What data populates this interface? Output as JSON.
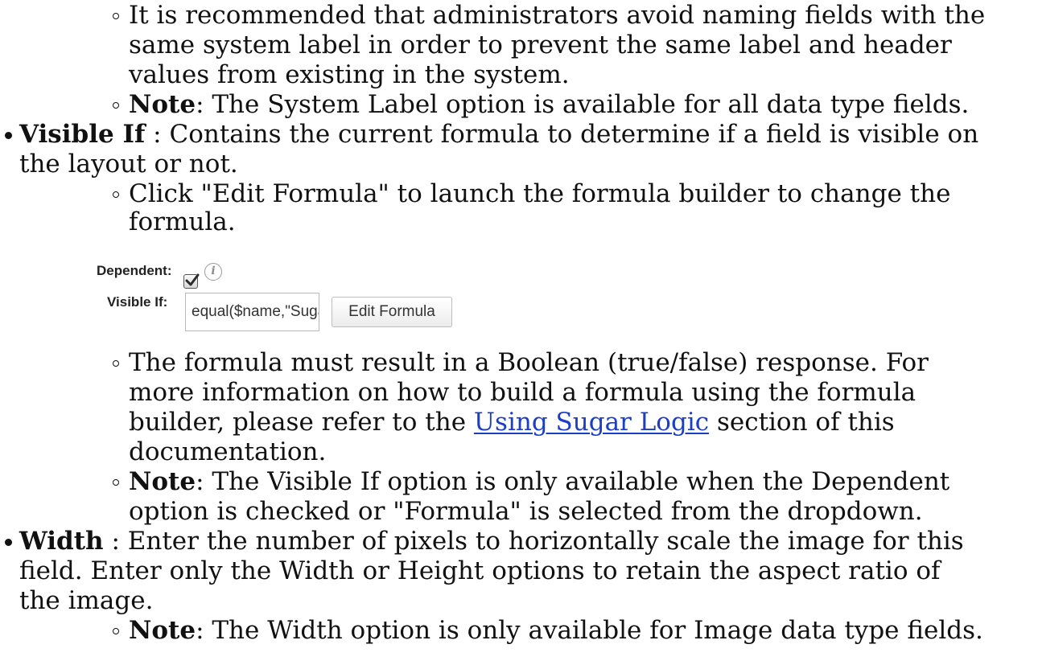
{
  "system_label_section": {
    "recommendation_lines": [
      "It is recommended that administrators avoid naming fields with the",
      "same system label in order to prevent the same label and header",
      "values from existing in the system."
    ],
    "note_bold": "Note",
    "note_text": ": The System Label option is available for all data type fields."
  },
  "visible_if_section": {
    "term": "Visible If",
    "desc_line1": " : Contains the current formula to determine if a field is visible on",
    "desc_line2": "the layout or not.",
    "edit_lines": [
      "Click \"Edit Formula\" to launch the formula builder to change the",
      "formula."
    ],
    "screenshot": {
      "dependent_label": "Dependent:",
      "dependent_checked": true,
      "info_icon_glyph": "i",
      "visible_if_label": "Visible If:",
      "formula_value": "equal($name,\"SugarCR",
      "edit_button_label": "Edit Formula"
    },
    "boolean_line1": "The formula must result in a Boolean (true/false) response. For",
    "boolean_line2": "more information on how to build a formula using the formula",
    "boolean_line3_pre": "builder, please refer to the ",
    "boolean_link": "Using Sugar Logic",
    "boolean_line3_post": " section of this",
    "boolean_line4": "documentation.",
    "note_bold": "Note",
    "note_line1": ": The Visible If option is only available when the Dependent",
    "note_line2": "option is checked or \"Formula\" is selected from the dropdown."
  },
  "width_section": {
    "term": "Width",
    "desc_lines": [
      " : Enter the number of pixels to horizontally scale the image for this",
      "field. Enter only the Width or Height options to retain the aspect ratio of",
      "the image."
    ],
    "note_bold": "Note",
    "note_text": ": The Width option is only available for Image data type fields."
  },
  "colors": {
    "text": "#111111",
    "link": "#1a3ec4",
    "checkmark": "#2b2b2b"
  }
}
